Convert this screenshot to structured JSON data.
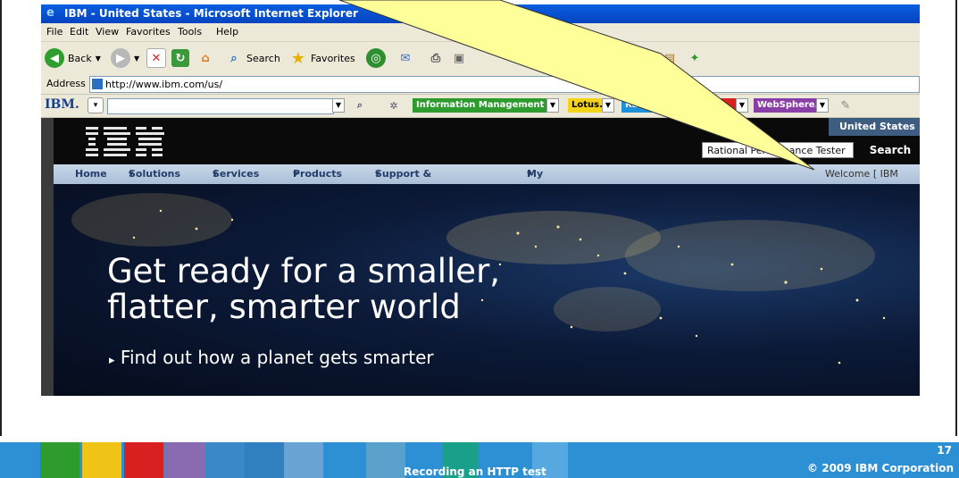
{
  "window": {
    "title": "IBM - United States - Microsoft Internet Explorer"
  },
  "menu": [
    "File",
    "Edit",
    "View",
    "Favorites",
    "Tools",
    "Help"
  ],
  "toolbar": {
    "back": "Back",
    "search": "Search",
    "favorites": "Favorites"
  },
  "address": {
    "label": "Address",
    "url": "http://www.ibm.com/us/"
  },
  "ibm_toolbar": {
    "logo": "IBM.",
    "products": [
      {
        "label": "Information Management",
        "color": "#2e9b2e"
      },
      {
        "label": "Lotus.",
        "color": "#f3d21a"
      },
      {
        "label": "Rational.",
        "color": "#1e90d8"
      },
      {
        "label": "",
        "color": "#d82020"
      },
      {
        "label": "WebSphere.",
        "color": "#8a3fa6"
      }
    ]
  },
  "site": {
    "country": "United States",
    "search_value": "Rational Performance Tester",
    "search_label": "Search",
    "nav": [
      "Home",
      "Solutions",
      "Services",
      "Products",
      "Support & downloads",
      "My IBM"
    ],
    "welcome": "Welcome [ IBM Sign",
    "headline_line1": "Get ready for a smaller,",
    "headline_line2": "flatter, smarter world",
    "promo_link": "Find out how a planet gets smarter"
  },
  "footer": {
    "caption": "Recording an HTTP test",
    "page": "17",
    "copyright": "© 2009 IBM Corporation"
  },
  "colors": {
    "footer_blue": "#2d8fd4",
    "callout_yellow": "#ffff99"
  }
}
